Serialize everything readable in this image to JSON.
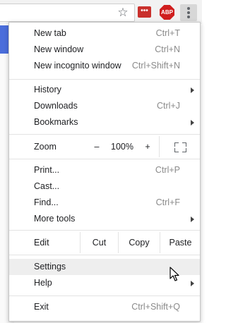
{
  "toolbar": {
    "star_icon": "star-icon",
    "extension_icon": "extension-icon",
    "extension_glyph": "•••",
    "abp_label": "ABP",
    "menu_icon": "kebab-menu-icon"
  },
  "menu": {
    "new_tab": {
      "label": "New tab",
      "shortcut": "Ctrl+T"
    },
    "new_window": {
      "label": "New window",
      "shortcut": "Ctrl+N"
    },
    "new_incognito": {
      "label": "New incognito window",
      "shortcut": "Ctrl+Shift+N"
    },
    "history": {
      "label": "History"
    },
    "downloads": {
      "label": "Downloads",
      "shortcut": "Ctrl+J"
    },
    "bookmarks": {
      "label": "Bookmarks"
    },
    "zoom": {
      "label": "Zoom",
      "minus": "–",
      "value": "100%",
      "plus": "+"
    },
    "print": {
      "label": "Print...",
      "shortcut": "Ctrl+P"
    },
    "cast": {
      "label": "Cast..."
    },
    "find": {
      "label": "Find...",
      "shortcut": "Ctrl+F"
    },
    "more_tools": {
      "label": "More tools"
    },
    "edit": {
      "label": "Edit",
      "cut": "Cut",
      "copy": "Copy",
      "paste": "Paste"
    },
    "settings": {
      "label": "Settings"
    },
    "help": {
      "label": "Help"
    },
    "exit": {
      "label": "Exit",
      "shortcut": "Ctrl+Shift+Q"
    }
  },
  "colors": {
    "hover_bg": "#eeeeee",
    "extension_red": "#c9302c",
    "abp_red": "#d01f1f",
    "page_accent_blue": "#4a6ddb"
  }
}
